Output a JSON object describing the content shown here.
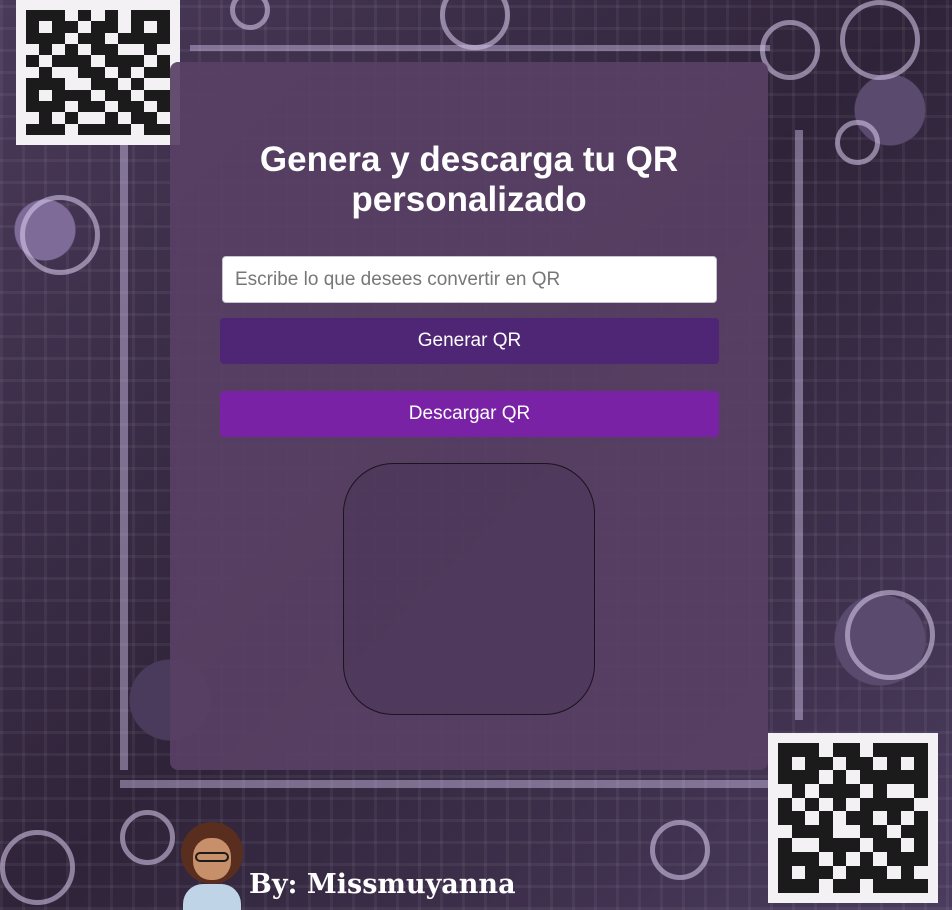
{
  "page": {
    "title": "Genera y descarga tu QR personalizado"
  },
  "form": {
    "input_placeholder": "Escribe lo que desees convertir en QR",
    "input_value": "",
    "generate_label": "Generar QR",
    "download_label": "Descargar QR"
  },
  "footer": {
    "signature": "By: Missmuyanna"
  },
  "colors": {
    "card_background": "#584064",
    "generate_button": "#4f2575",
    "download_button": "#7a22a6",
    "title_text": "#ffffff"
  }
}
